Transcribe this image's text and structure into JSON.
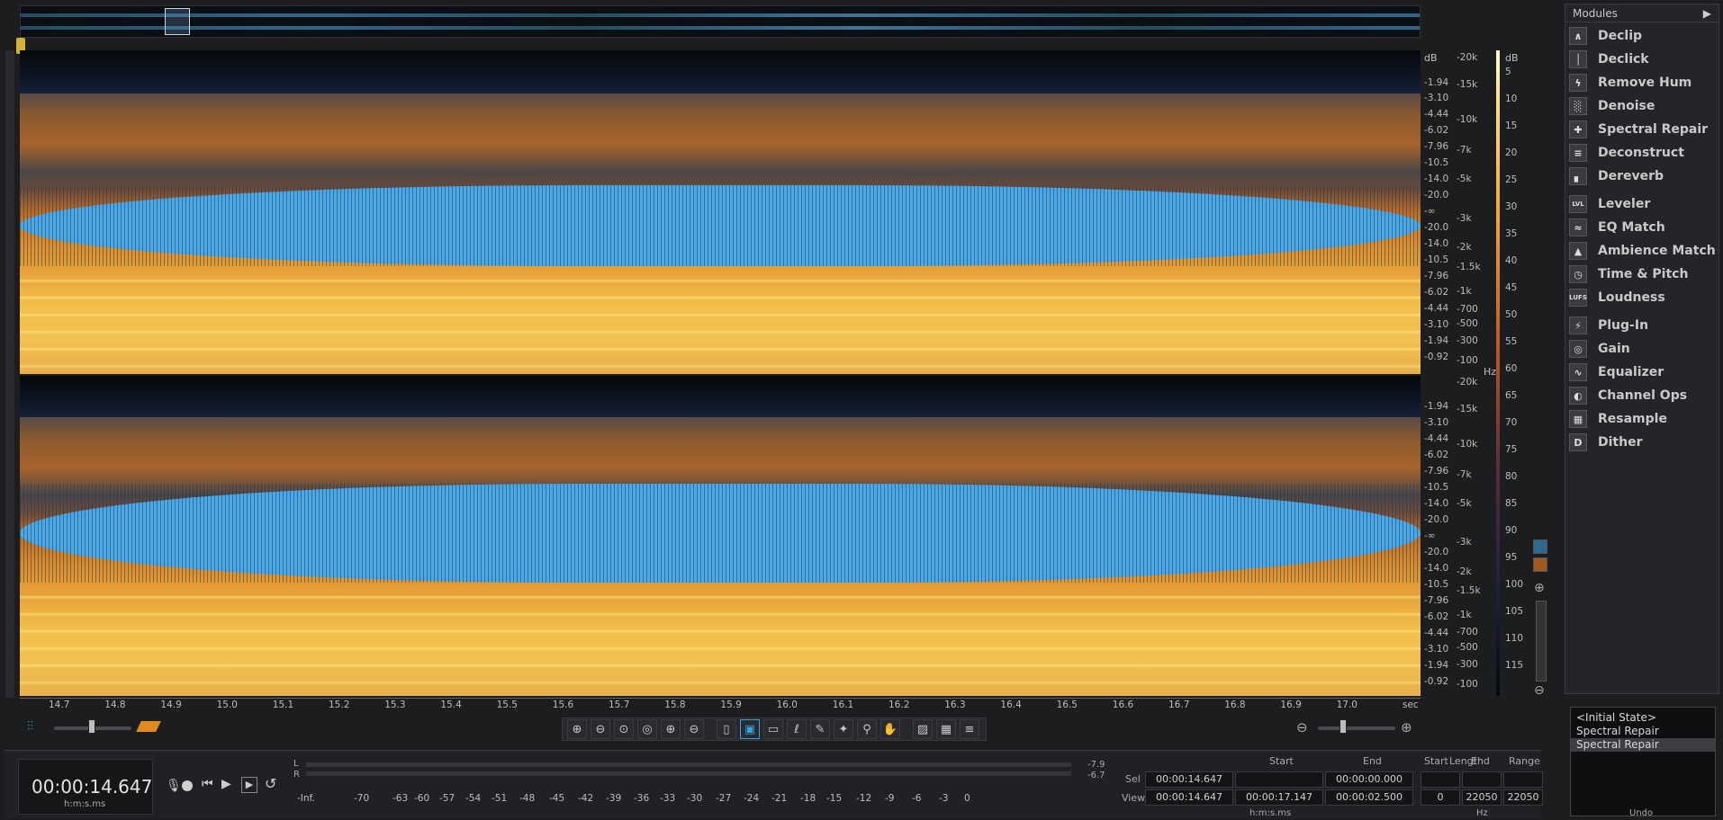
{
  "overview": {
    "label": "overview"
  },
  "db_scale_left": {
    "unit": "dB",
    "top": [
      "-1.94",
      "-3.10",
      "-4.44",
      "-6.02",
      "-7.96",
      "-10.5",
      "-14.0",
      "-20.0",
      "-∞",
      "-20.0",
      "-14.0",
      "-10.5",
      "-7.96",
      "-6.02",
      "-4.44",
      "-3.10",
      "-1.94",
      "-0.92"
    ],
    "bottom": [
      "-1.94",
      "-3.10",
      "-4.44",
      "-6.02",
      "-7.96",
      "-10.5",
      "-14.0",
      "-20.0",
      "-∞",
      "-20.0",
      "-14.0",
      "-10.5",
      "-7.96",
      "-6.02",
      "-4.44",
      "-3.10",
      "-1.94",
      "-0.92"
    ]
  },
  "hz_scale": {
    "unit": "Hz",
    "top": [
      "-20k",
      "-15k",
      "-10k",
      "-7k",
      "-5k",
      "-3k",
      "-2k",
      "-1.5k",
      "-1k",
      "-700",
      "-500",
      "-300",
      "-100"
    ],
    "bottom": [
      "-20k",
      "-15k",
      "-10k",
      "-7k",
      "-5k",
      "-3k",
      "-2k",
      "-1.5k",
      "-1k",
      "-700",
      "-500",
      "-300",
      "-100"
    ]
  },
  "colorbar": {
    "unit": "dB",
    "ticks": [
      "5",
      "10",
      "15",
      "20",
      "25",
      "30",
      "35",
      "40",
      "45",
      "50",
      "55",
      "60",
      "65",
      "70",
      "75",
      "80",
      "85",
      "90",
      "95",
      "100",
      "105",
      "110",
      "115"
    ]
  },
  "time_ruler": {
    "ticks": [
      "14.7",
      "14.8",
      "14.9",
      "15.0",
      "15.1",
      "15.2",
      "15.3",
      "15.4",
      "15.5",
      "15.6",
      "15.7",
      "15.8",
      "15.9",
      "16.0",
      "16.1",
      "16.2",
      "16.3",
      "16.4",
      "16.5",
      "16.6",
      "16.7",
      "16.8",
      "16.9",
      "17.0"
    ],
    "unit": "sec"
  },
  "modules": {
    "header": "Modules",
    "items": [
      {
        "label": "Declip",
        "icon": "declip-icon",
        "glyph": "∧"
      },
      {
        "label": "Declick",
        "icon": "declick-icon",
        "glyph": "│"
      },
      {
        "label": "Remove Hum",
        "icon": "hum-icon",
        "glyph": "ϟ"
      },
      {
        "label": "Denoise",
        "icon": "denoise-icon",
        "glyph": "░"
      },
      {
        "label": "Spectral Repair",
        "icon": "spectral-repair-icon",
        "glyph": "✚"
      },
      {
        "label": "Deconstruct",
        "icon": "deconstruct-icon",
        "glyph": "≡"
      },
      {
        "label": "Dereverb",
        "icon": "dereverb-icon",
        "glyph": "▖"
      },
      {
        "label": "Leveler",
        "icon": "leveler-icon",
        "glyph": "LVL"
      },
      {
        "label": "EQ Match",
        "icon": "eq-match-icon",
        "glyph": "≈"
      },
      {
        "label": "Ambience Match",
        "icon": "ambience-icon",
        "glyph": "▲"
      },
      {
        "label": "Time & Pitch",
        "icon": "time-pitch-icon",
        "glyph": "◷"
      },
      {
        "label": "Loudness",
        "icon": "loudness-icon",
        "glyph": "LUFS"
      },
      {
        "label": "Plug-In",
        "icon": "plugin-icon",
        "glyph": "⚡"
      },
      {
        "label": "Gain",
        "icon": "gain-icon",
        "glyph": "◎"
      },
      {
        "label": "Equalizer",
        "icon": "equalizer-icon",
        "glyph": "∿"
      },
      {
        "label": "Channel Ops",
        "icon": "channel-ops-icon",
        "glyph": "◐"
      },
      {
        "label": "Resample",
        "icon": "resample-icon",
        "glyph": "▦"
      },
      {
        "label": "Dither",
        "icon": "dither-icon",
        "glyph": "D"
      }
    ]
  },
  "undo": {
    "title": "Undo",
    "items": [
      "<Initial State>",
      "Spectral Repair",
      "Spectral Repair"
    ]
  },
  "transport": {
    "timecode": "00:00:14.647",
    "timecode_unit": "h:m:s.ms"
  },
  "meter": {
    "L": "L",
    "R": "R",
    "peak_l": "-7.9",
    "peak_r": "-6.7",
    "ticks": [
      "-Inf.",
      "-70",
      "-63",
      "-60",
      "-57",
      "-54",
      "-51",
      "-48",
      "-45",
      "-42",
      "-39",
      "-36",
      "-33",
      "-30",
      "-27",
      "-24",
      "-21",
      "-18",
      "-15",
      "-12",
      "-9",
      "-6",
      "-3",
      "0"
    ]
  },
  "selection": {
    "headers": [
      "Start",
      "End",
      "Length"
    ],
    "sel_label": "Sel",
    "view_label": "View",
    "sel": [
      "00:00:14.647",
      "",
      "00:00:00.000"
    ],
    "view": [
      "00:00:14.647",
      "00:00:17.147",
      "00:00:02.500"
    ],
    "unit": "h:m:s.ms",
    "freq_headers": [
      "Start",
      "End",
      "Range"
    ],
    "freq": [
      "0",
      "22050",
      "22050"
    ],
    "freq_unit": "Hz"
  }
}
